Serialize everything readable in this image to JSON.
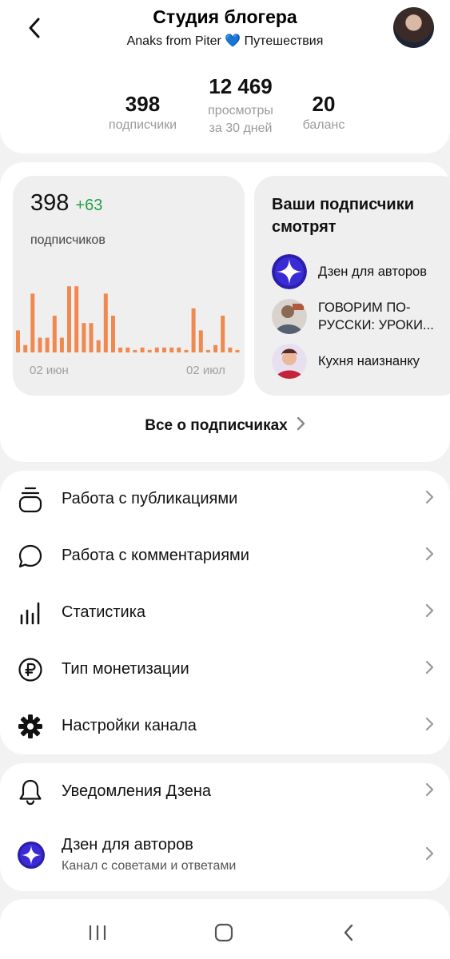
{
  "header": {
    "title": "Студия блогера",
    "subtitle_prefix": "Anaks from Piter ",
    "subtitle_heart": "💙",
    "subtitle_suffix": " Путешествия"
  },
  "stats": [
    {
      "value": "398",
      "label1": "подписчики",
      "label2": ""
    },
    {
      "value": "12 469",
      "label1": "просмотры",
      "label2": "за 30 дней"
    },
    {
      "value": "20",
      "label1": "баланс",
      "label2": ""
    }
  ],
  "subscribers_card": {
    "count": "398",
    "delta": "+63",
    "label": "подписчиков",
    "x_label_start": "02 июн",
    "x_label_end": "02 июл"
  },
  "chart_data": {
    "type": "bar",
    "values": [
      9,
      3,
      24,
      6,
      6,
      15,
      6,
      27,
      27,
      12,
      12,
      5,
      24,
      15,
      2,
      2,
      1,
      2,
      1,
      2,
      2,
      2,
      2,
      1,
      18,
      9,
      1,
      3,
      15,
      2,
      1
    ],
    "ylim": [
      0,
      30
    ],
    "color": "#f0894f",
    "grid": false
  },
  "watching": {
    "title": "Ваши подписчики смотрят",
    "items": [
      {
        "label": "Дзен для авторов"
      },
      {
        "label": "ГОВОРИМ ПО-РУССКИ: УРОКИ..."
      },
      {
        "label": "Кухня наизнанку"
      }
    ]
  },
  "all_subscribers": {
    "label": "Все о подписчиках"
  },
  "menu": [
    {
      "label": "Работа с публикациями",
      "icon": "publications-icon"
    },
    {
      "label": "Работа с комментариями",
      "icon": "comments-icon"
    },
    {
      "label": "Статистика",
      "icon": "statistics-icon"
    },
    {
      "label": "Тип монетизации",
      "icon": "ruble-icon"
    },
    {
      "label": "Настройки канала",
      "icon": "gear-icon"
    }
  ],
  "menu2": [
    {
      "label": "Уведомления Дзена",
      "icon": "bell-icon"
    },
    {
      "label": "Дзен для авторов",
      "sub": "Канал с советами и ответами",
      "icon": "zen-logo-icon"
    }
  ],
  "colors": {
    "accent_green": "#23a047",
    "bar_orange": "#f0894f",
    "zen_blue": "#3b2bd6"
  }
}
